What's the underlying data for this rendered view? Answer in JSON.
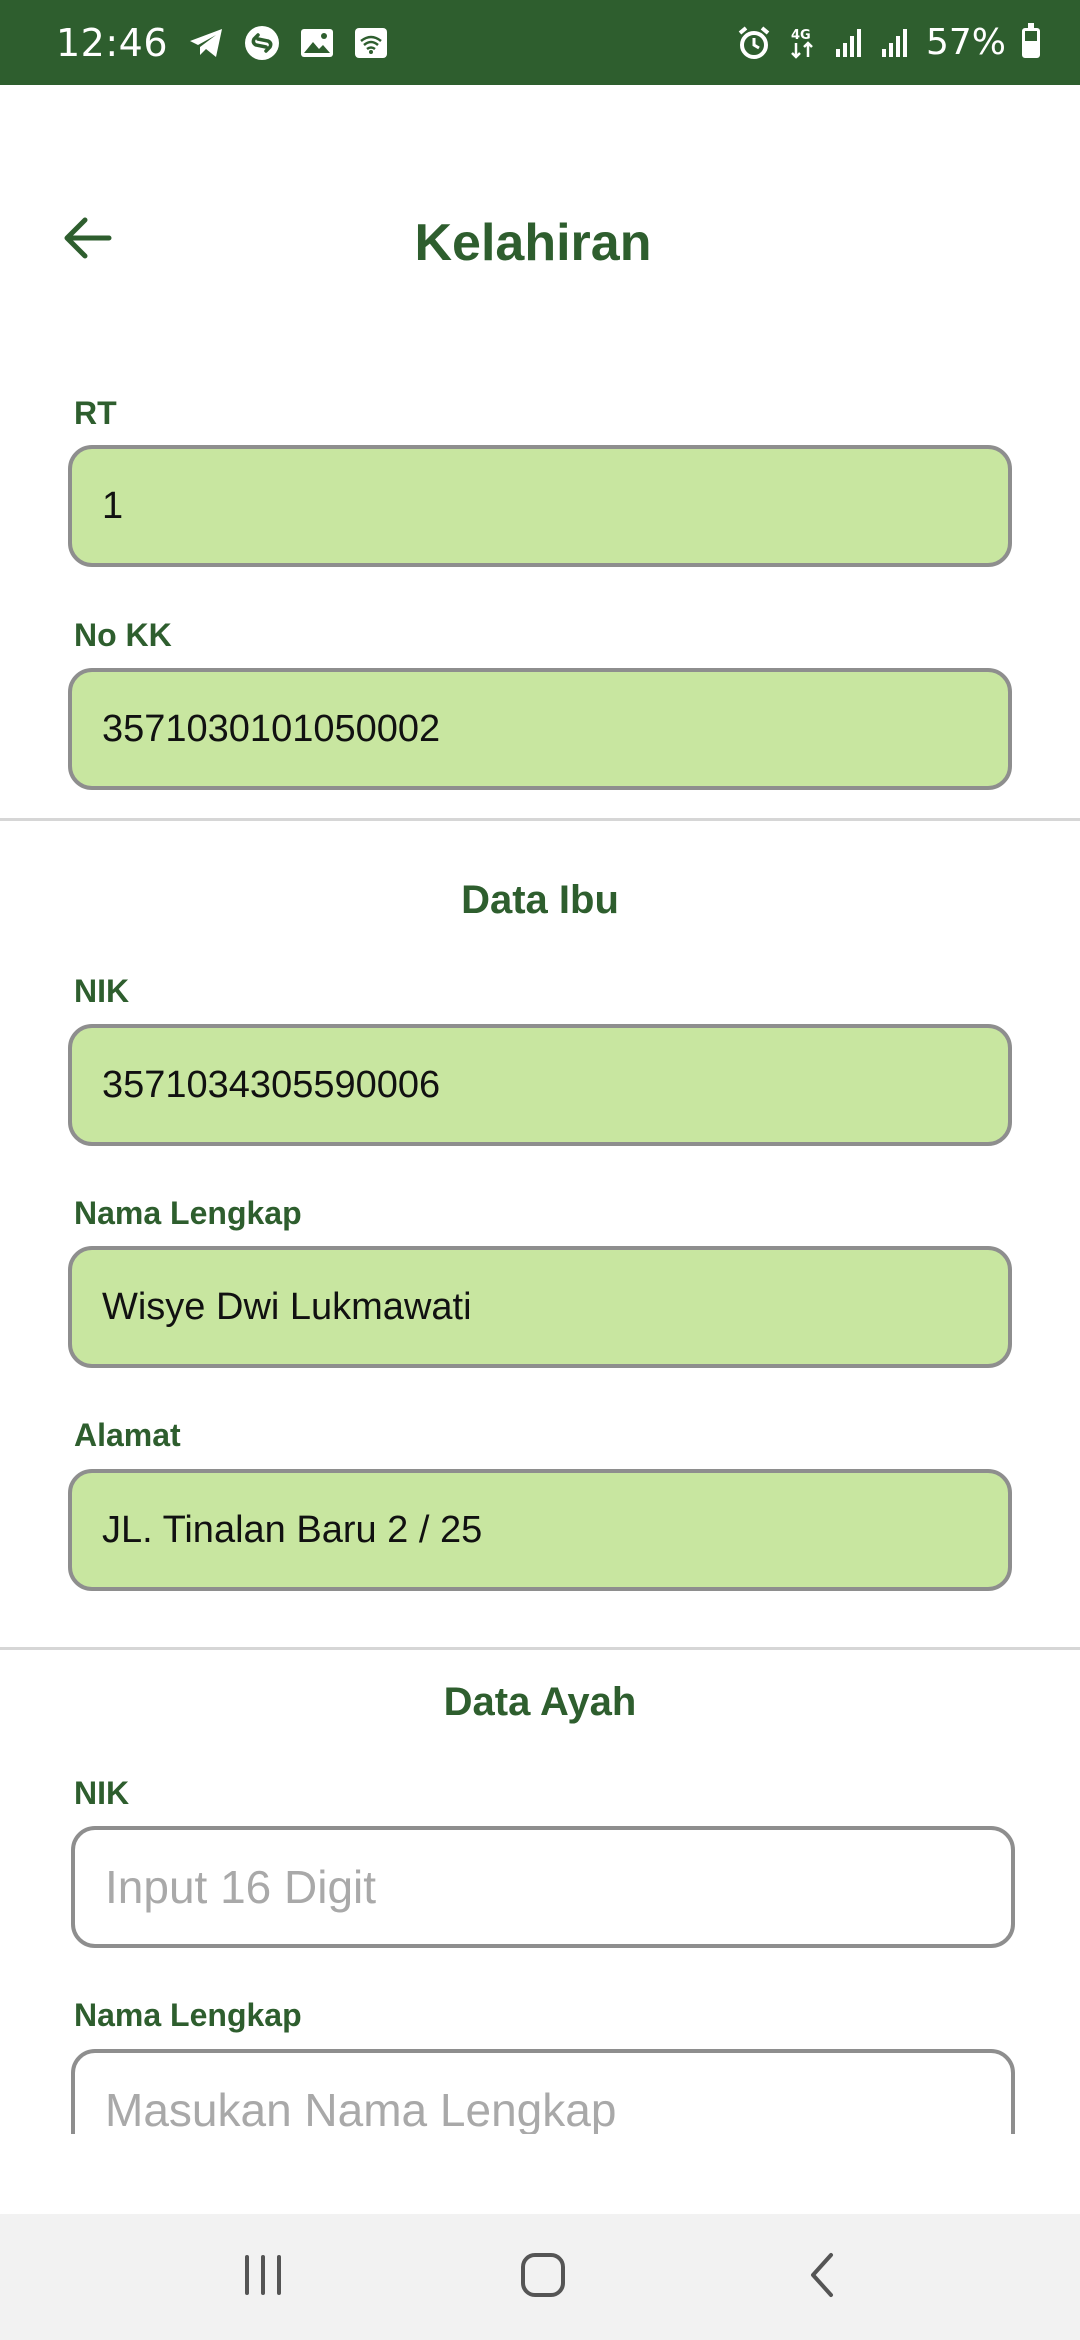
{
  "status_bar": {
    "time": "12:46",
    "battery": "57%",
    "battery_level": 0.57,
    "icons_left": [
      "telegram-icon",
      "shazam-icon",
      "gallery-icon",
      "wifi-cast-icon"
    ],
    "icons_right": [
      "alarm-icon",
      "4g-icon",
      "signal-icon",
      "signal-icon"
    ]
  },
  "header": {
    "title": "Kelahiran"
  },
  "form": {
    "rt": {
      "label": "RT",
      "value": "1"
    },
    "no_kk": {
      "label": "No KK",
      "value": "3571030101050002"
    }
  },
  "ibu": {
    "section_title": "Data Ibu",
    "nik": {
      "label": "NIK",
      "value": "3571034305590006"
    },
    "nama": {
      "label": "Nama Lengkap",
      "value": "Wisye Dwi Lukmawati"
    },
    "alamat": {
      "label": "Alamat",
      "value": "JL. Tinalan Baru 2 / 25"
    }
  },
  "ayah": {
    "section_title": "Data Ayah",
    "nik": {
      "label": "NIK",
      "placeholder": "Input 16 Digit"
    },
    "nama": {
      "label": "Nama Lengkap",
      "placeholder": "Masukan Nama Lengkap"
    }
  },
  "colors": {
    "primary": "#2e5e2e",
    "filled_field": "#c8e6a0",
    "field_border": "#8e8e8e"
  }
}
